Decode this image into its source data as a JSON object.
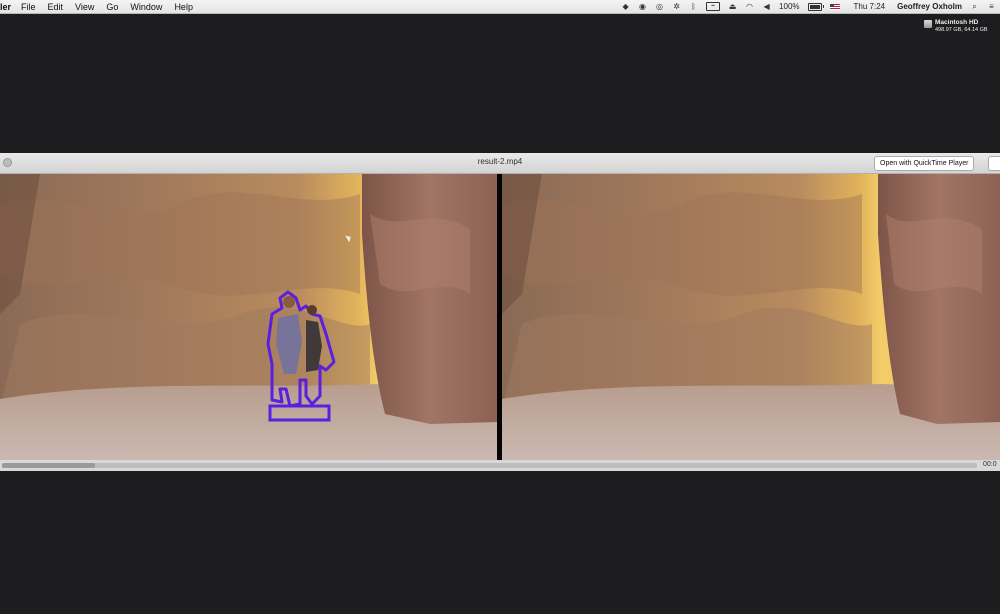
{
  "menubar": {
    "items": [
      "ler",
      "File",
      "Edit",
      "View",
      "Go",
      "Window",
      "Help"
    ],
    "battery_text": "100%",
    "battery_level": 1.0,
    "clock": "Thu 7:24",
    "user": "Geoffrey Oxholm",
    "status_icons": [
      "dropbox-icon",
      "camera-icon",
      "search-circle-icon",
      "gear-icon",
      "bluetooth-icon",
      "display-icon",
      "eject-icon",
      "wifi-icon",
      "volume-icon"
    ]
  },
  "desktop": {
    "disk_name": "Macintosh HD",
    "disk_size": "498.97 GB, 64.14 GB"
  },
  "window": {
    "title": "result-2.mp4",
    "open_button": "Open with QuickTime Player",
    "time": "00:0",
    "progress": 0.095
  },
  "colors": {
    "selection_outline": "#5a1fe0"
  }
}
